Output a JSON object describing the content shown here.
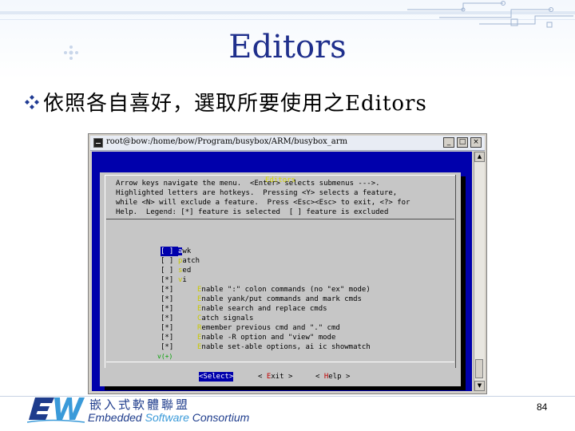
{
  "slide": {
    "title": "Editors",
    "bullet_icon": "diamond-cluster-bullet",
    "bullet_text": "依照各自喜好，選取所要使用之Editors",
    "page_number": "84"
  },
  "window": {
    "title": "root@bow:/home/bow/Program/busybox/ARM/busybox_arm",
    "min_symbol": "_",
    "max_symbol": "□",
    "close_symbol": "×",
    "scroll_up": "▲",
    "scroll_down": "▼"
  },
  "dialog": {
    "title": "Editors",
    "help_text": "Arrow keys navigate the menu.  <Enter> selects submenus --->.\nHighlighted letters are hotkeys.  Pressing <Y> selects a feature,\nwhile <N> will exclude a feature.  Press <Esc><Esc> to exit, <?> for\nHelp.  Legend: [*] feature is selected  [ ] feature is excluded",
    "more_indicator": "v(+)",
    "items": [
      {
        "check": "[ ]",
        "hotkey": "a",
        "rest": "wk",
        "indent": false,
        "selected": true
      },
      {
        "check": "[ ]",
        "hotkey": "p",
        "rest": "atch",
        "indent": false,
        "selected": false
      },
      {
        "check": "[ ]",
        "hotkey": "s",
        "rest": "ed",
        "indent": false,
        "selected": false
      },
      {
        "check": "[*]",
        "hotkey": "v",
        "rest": "i",
        "indent": false,
        "selected": false
      },
      {
        "check": "[*]",
        "hotkey": "E",
        "rest": "nable \":\" colon commands (no \"ex\" mode)",
        "indent": true,
        "selected": false
      },
      {
        "check": "[*]",
        "hotkey": "E",
        "rest": "nable yank/put commands and mark cmds",
        "indent": true,
        "selected": false
      },
      {
        "check": "[*]",
        "hotkey": "E",
        "rest": "nable search and replace cmds",
        "indent": true,
        "selected": false
      },
      {
        "check": "[*]",
        "hotkey": "C",
        "rest": "atch signals",
        "indent": true,
        "selected": false
      },
      {
        "check": "[*]",
        "hotkey": "R",
        "rest": "emember previous cmd and \".\" cmd",
        "indent": true,
        "selected": false
      },
      {
        "check": "[*]",
        "hotkey": "E",
        "rest": "nable -R option and \"view\" mode",
        "indent": true,
        "selected": false
      },
      {
        "check": "[*]",
        "hotkey": "E",
        "rest": "nable set-able options, ai ic showmatch",
        "indent": true,
        "selected": false
      }
    ],
    "buttons": {
      "select": "<Select>",
      "exit_pre": "< ",
      "exit_hotkey": "E",
      "exit_post": "xit >",
      "help_pre": "< ",
      "help_hotkey": "H",
      "help_post": "elp >"
    }
  },
  "footer": {
    "logo_cn": "嵌入式軟體聯盟",
    "logo_en_1": "Embedded ",
    "logo_en_2": "Software",
    "logo_en_3": " Consortium"
  },
  "colors": {
    "title_blue": "#1f2f8c",
    "terminal_blue": "#0000ac",
    "dialog_gray": "#c6c6c6",
    "hotkey_yellow": "#c8c800",
    "hotkey_red": "#c00000"
  }
}
